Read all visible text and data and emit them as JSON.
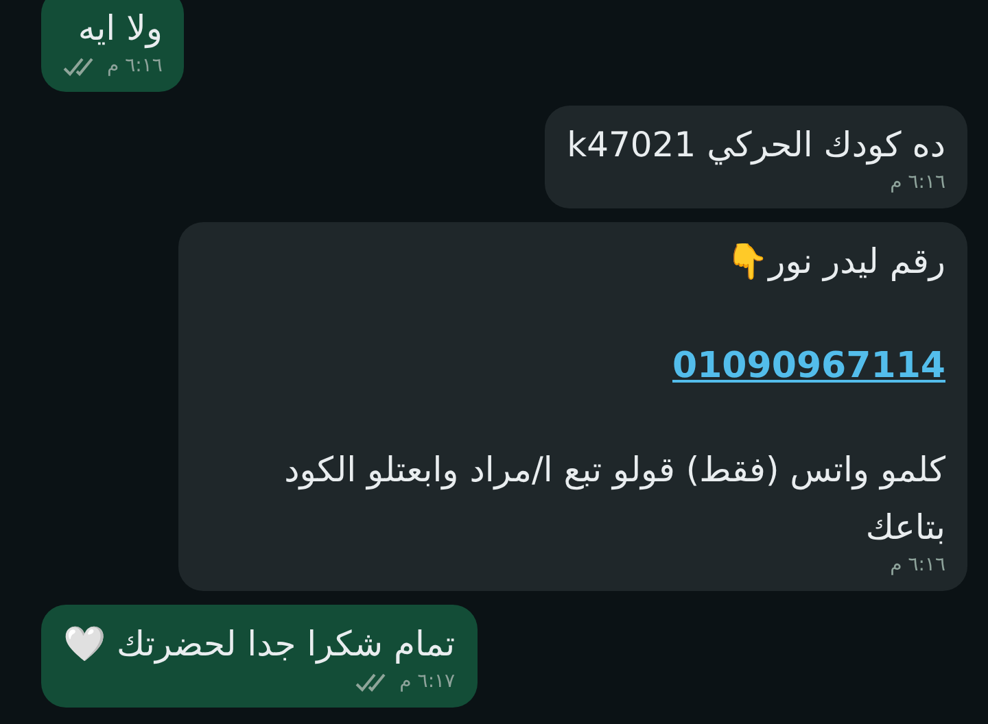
{
  "messages": [
    {
      "kind": "outgoing",
      "blocks": [
        {
          "kind": "text",
          "text": "ولا ايه"
        }
      ],
      "time": "٦:١٦ م",
      "read": false
    },
    {
      "kind": "incoming",
      "blocks": [
        {
          "kind": "text",
          "text": "ده كودك الحركي  k47021"
        }
      ],
      "time": "٦:١٦ م"
    },
    {
      "kind": "incoming",
      "blocks": [
        {
          "kind": "text",
          "text": "رقم ليدر نور👇"
        },
        {
          "kind": "link",
          "text": "01090967114"
        },
        {
          "kind": "text",
          "text": "كلمو واتس (فقط) قولو تبع ا/مراد وابعتلو الكود بتاعك"
        }
      ],
      "time": "٦:١٦ م"
    },
    {
      "kind": "outgoing",
      "blocks": [
        {
          "kind": "text",
          "text": "تمام شكرا جدا لحضرتك 🤍"
        }
      ],
      "time": "٦:١٧ م",
      "read": false
    }
  ]
}
